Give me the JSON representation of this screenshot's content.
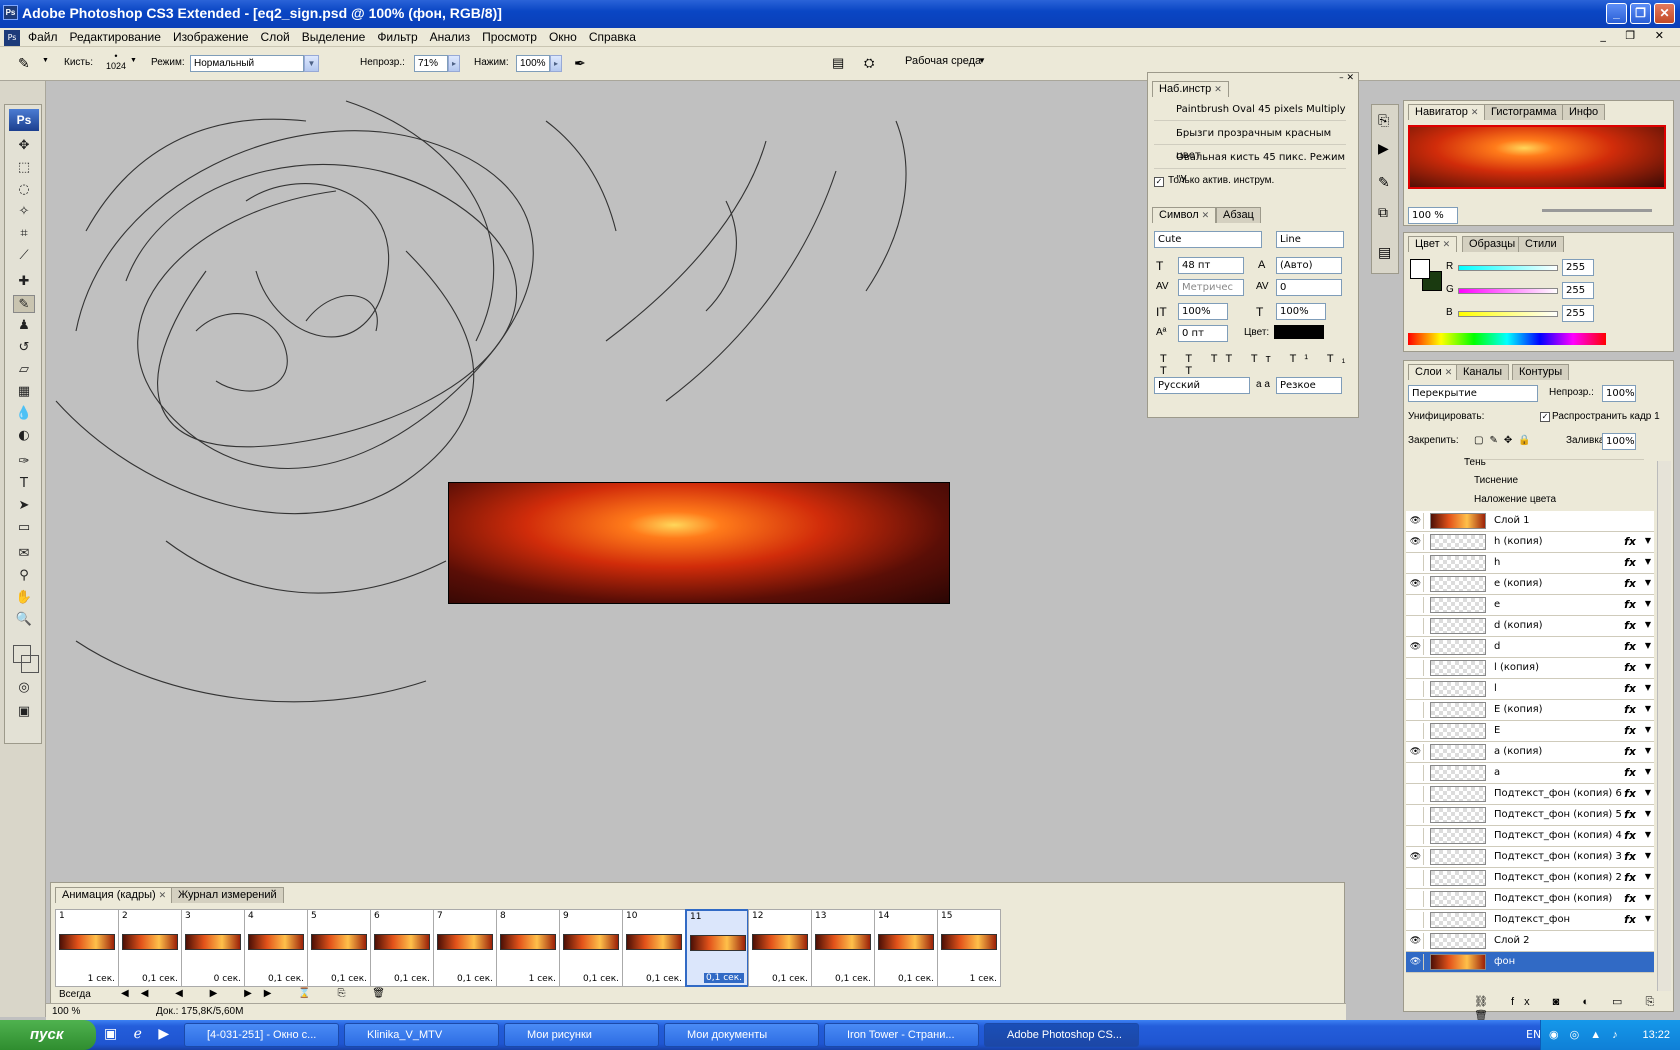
{
  "window": {
    "title": "Adobe Photoshop CS3 Extended - [eq2_sign.psd @ 100% (фон, RGB/8)]",
    "app_icon": "Ps"
  },
  "menu": [
    "Файл",
    "Редактирование",
    "Изображение",
    "Слой",
    "Выделение",
    "Фильтр",
    "Анализ",
    "Просмотр",
    "Окно",
    "Справка"
  ],
  "options": {
    "brush_label": "Кисть:",
    "brush_size": "1024",
    "mode_label": "Режим:",
    "mode_value": "Нормальный",
    "opacity_label": "Непрозр.:",
    "opacity_value": "71%",
    "flow_label": "Нажим:",
    "flow_value": "100%",
    "workspace": "Рабочая среда"
  },
  "toolbox": {
    "logo": "Ps"
  },
  "tool_presets": {
    "tab": "Наб.инстр",
    "items": [
      "Paintbrush Oval 45 pixels Multiply",
      "Брызги прозрачным красным цвет",
      "Овальная кисть 45 пикс. Режим \"У"
    ],
    "only_active": "Только актив. инструм."
  },
  "character": {
    "tabs": [
      "Символ",
      "Абзац"
    ],
    "font": "Cute",
    "style": "Line",
    "size": "48 пт",
    "leading": "(Авто)",
    "kerning": "Метричес",
    "tracking": "0",
    "vscale": "100%",
    "hscale": "100%",
    "baseline": "0 пт",
    "color_label": "Цвет:",
    "language": "Русский",
    "aa_label": "a a",
    "antialias": "Резкое"
  },
  "navigator": {
    "tabs": [
      "Навигатор",
      "Гистограмма",
      "Инфо"
    ],
    "zoom": "100 %"
  },
  "color": {
    "tabs": [
      "Цвет",
      "Образцы",
      "Стили"
    ],
    "r_label": "R",
    "g_label": "G",
    "b_label": "B",
    "r": "255",
    "g": "255",
    "b": "255"
  },
  "layers": {
    "tabs": [
      "Слои",
      "Каналы",
      "Контуры"
    ],
    "blend": "Перекрытие",
    "opacity_label": "Непрозр.:",
    "opacity": "100%",
    "unify_label": "Унифицировать:",
    "propagate": "Распространить кадр 1",
    "lock_label": "Закрепить:",
    "fill_label": "Заливка:",
    "fill": "100%",
    "effects": [
      "Тень",
      "Тиснение",
      "Наложение цвета"
    ],
    "items": [
      {
        "name": "Слой 1",
        "eye": true,
        "fx": false,
        "img": true
      },
      {
        "name": "h (копия)",
        "eye": true,
        "fx": true
      },
      {
        "name": "h",
        "eye": false,
        "fx": true
      },
      {
        "name": "e (копия)",
        "eye": true,
        "fx": true
      },
      {
        "name": "e",
        "eye": false,
        "fx": true
      },
      {
        "name": "d (копия)",
        "eye": false,
        "fx": true
      },
      {
        "name": "d",
        "eye": true,
        "fx": true
      },
      {
        "name": "l (копия)",
        "eye": false,
        "fx": true
      },
      {
        "name": "l",
        "eye": false,
        "fx": true
      },
      {
        "name": "E (копия)",
        "eye": false,
        "fx": true
      },
      {
        "name": "E",
        "eye": false,
        "fx": true
      },
      {
        "name": "a (копия)",
        "eye": true,
        "fx": true
      },
      {
        "name": "a",
        "eye": false,
        "fx": true
      },
      {
        "name": "Подтекст_фон (копия) 6",
        "eye": false,
        "fx": true
      },
      {
        "name": "Подтекст_фон (копия) 5",
        "eye": false,
        "fx": true
      },
      {
        "name": "Подтекст_фон (копия) 4",
        "eye": false,
        "fx": true
      },
      {
        "name": "Подтекст_фон (копия) 3",
        "eye": true,
        "fx": true
      },
      {
        "name": "Подтекст_фон (копия) 2",
        "eye": false,
        "fx": true
      },
      {
        "name": "Подтекст_фон (копия)",
        "eye": false,
        "fx": true
      },
      {
        "name": "Подтекст_фон",
        "eye": false,
        "fx": true
      },
      {
        "name": "Слой 2",
        "eye": true,
        "fx": false
      },
      {
        "name": "фон",
        "eye": true,
        "fx": false,
        "img": true,
        "selected": true
      }
    ]
  },
  "animation": {
    "tabs": [
      "Анимация (кадры)",
      "Журнал измерений"
    ],
    "loop": "Всегда",
    "frames": [
      {
        "n": "1",
        "d": "1 сек."
      },
      {
        "n": "2",
        "d": "0,1 сек."
      },
      {
        "n": "3",
        "d": "0 сек."
      },
      {
        "n": "4",
        "d": "0,1 сек."
      },
      {
        "n": "5",
        "d": "0,1 сек."
      },
      {
        "n": "6",
        "d": "0,1 сек."
      },
      {
        "n": "7",
        "d": "0,1 сек."
      },
      {
        "n": "8",
        "d": "1 сек."
      },
      {
        "n": "9",
        "d": "0,1 сек."
      },
      {
        "n": "10",
        "d": "0,1 сек."
      },
      {
        "n": "11",
        "d": "0,1 сек.",
        "selected": true
      },
      {
        "n": "12",
        "d": "0,1 сек."
      },
      {
        "n": "13",
        "d": "0,1 сек."
      },
      {
        "n": "14",
        "d": "0,1 сек."
      },
      {
        "n": "15",
        "d": "1 сек."
      }
    ]
  },
  "status": {
    "zoom": "100 %",
    "doc": "Док.: 175,8K/5,60M"
  },
  "taskbar": {
    "start": "пуск",
    "tasks": [
      "[4-031-251] - Окно с...",
      "Klinika_V_MTV",
      "Мои рисунки",
      "Мои документы",
      "Iron Tower - Страни...",
      "Adobe Photoshop CS..."
    ],
    "lang": "EN",
    "time": "13:22"
  },
  "colors": {
    "fg_swatch": "#ffffff",
    "bg_swatch": "#1a3a10",
    "selection": "#316ac5"
  }
}
